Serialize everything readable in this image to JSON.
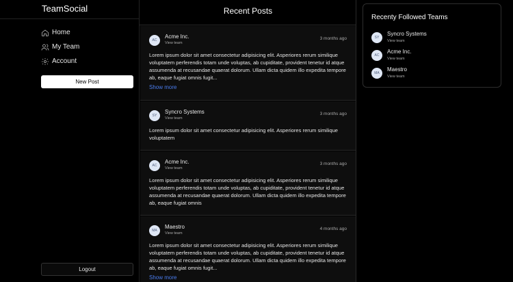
{
  "sidebar": {
    "brand": "TeamSocial",
    "nav": [
      {
        "label": "Home",
        "icon": "home-icon"
      },
      {
        "label": "My Team",
        "icon": "users-icon"
      },
      {
        "label": "Account",
        "icon": "gear-icon"
      }
    ],
    "new_post_label": "New Post",
    "logout_label": "Logout"
  },
  "feed": {
    "title": "Recent Posts",
    "posts": [
      {
        "initials": "AC",
        "author": "Acme Inc.",
        "view": "View team",
        "time": "3 months ago",
        "body": "Lorem ipsum dolor sit amet consectetur adipisicing elit. Asperiores rerum similique voluptatem perferendis totam unde voluptas, ab cupiditate, provident tenetur id atque assumenda at recusandae quaerat dolorum. Ullam dicta quidem illo expedita tempore ab, eaque fugiat omnis fugit...",
        "more": "Show more"
      },
      {
        "initials": "SY",
        "author": "Syncro Systems",
        "view": "View team",
        "time": "3 months ago",
        "body": "Lorem ipsum dolor sit amet consectetur adipisicing elit. Asperiores rerum similique voluptatem",
        "more": ""
      },
      {
        "initials": "AC",
        "author": "Acme Inc.",
        "view": "View team",
        "time": "3 months ago",
        "body": "Lorem ipsum dolor sit amet consectetur adipisicing elit. Asperiores rerum similique voluptatem perferendis totam unde voluptas, ab cupiditate, provident tenetur id atque assumenda at recusandae quaerat dolorum. Ullam dicta quidem illo expedita tempore ab, eaque fugiat omnis",
        "more": ""
      },
      {
        "initials": "MA",
        "author": "Maestro",
        "view": "View team",
        "time": "4 months ago",
        "body": "Lorem ipsum dolor sit amet consectetur adipisicing elit. Asperiores rerum similique voluptatem perferendis totam unde voluptas, ab cupiditate, provident tenetur id atque assumenda at recusandae quaerat dolorum. Ullam dicta quidem illo expedita tempore ab, eaque fugiat omnis fugit...",
        "more": "Show more"
      }
    ]
  },
  "followed": {
    "title": "Recenty Followed Teams",
    "teams": [
      {
        "initials": "SY",
        "name": "Syncro Systems",
        "view": "View team"
      },
      {
        "initials": "AC",
        "name": "Acme Inc.",
        "view": "View team"
      },
      {
        "initials": "MA",
        "name": "Maestro",
        "view": "View team"
      }
    ]
  }
}
